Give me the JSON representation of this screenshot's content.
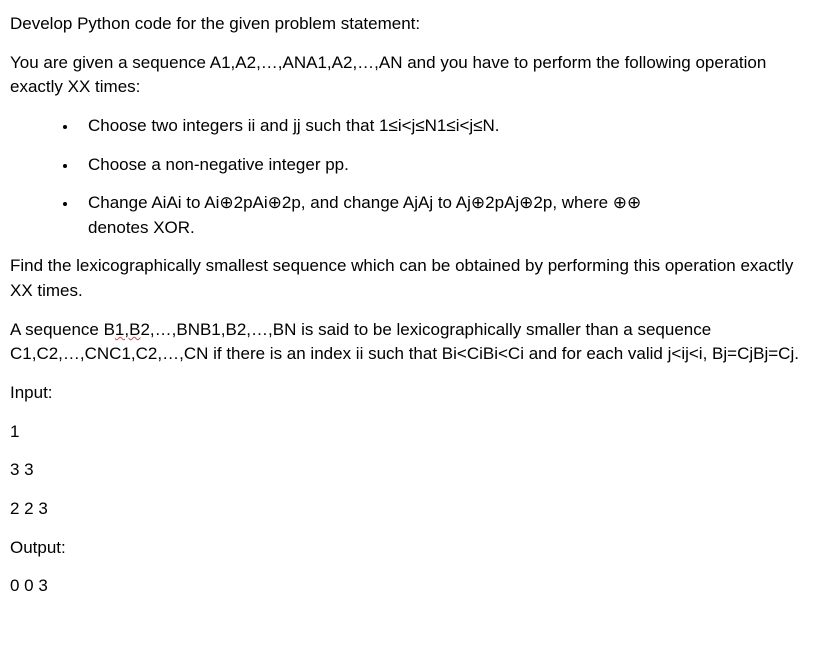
{
  "title": "Develop Python code for the given problem statement:",
  "statement": "You are given a sequence A1,A2,…,ANA1,A2,…,AN and you have to perform the following operation exactly XX times:",
  "bullets": [
    {
      "pre": "Choose two integers ii and ",
      "wavy": "jj",
      "post": " such that 1≤i<j≤N1≤i<j≤N."
    },
    {
      "pre": "Choose a non-negative integer pp.",
      "wavy": "",
      "post": ""
    },
    {
      "pre": "Change AiAi to Ai⊕2pAi⊕2p, and change AjAj to Aj⊕2pAj⊕2p, where ⊕⊕ denotes XOR.",
      "wavy": "",
      "post": ""
    }
  ],
  "followup": "Find the lexicographically smallest sequence which can be obtained by performing this operation exactly XX times.",
  "lex": {
    "pre": "A sequence B",
    "wavy": "1,B",
    "post": "2,…,BNB1,B2,…,BN is said to be lexicographically smaller than a sequence C1,C2,…,CNC1,C2,…,CN if there is an index ii such that Bi<CiBi<Ci and for each valid j<ij<i, Bj=CjBj=Cj."
  },
  "input_label": "Input:",
  "input_lines": [
    "1",
    "3 3",
    "2 2 3"
  ],
  "output_label": "Output:",
  "output_lines": [
    "0 0 3"
  ]
}
